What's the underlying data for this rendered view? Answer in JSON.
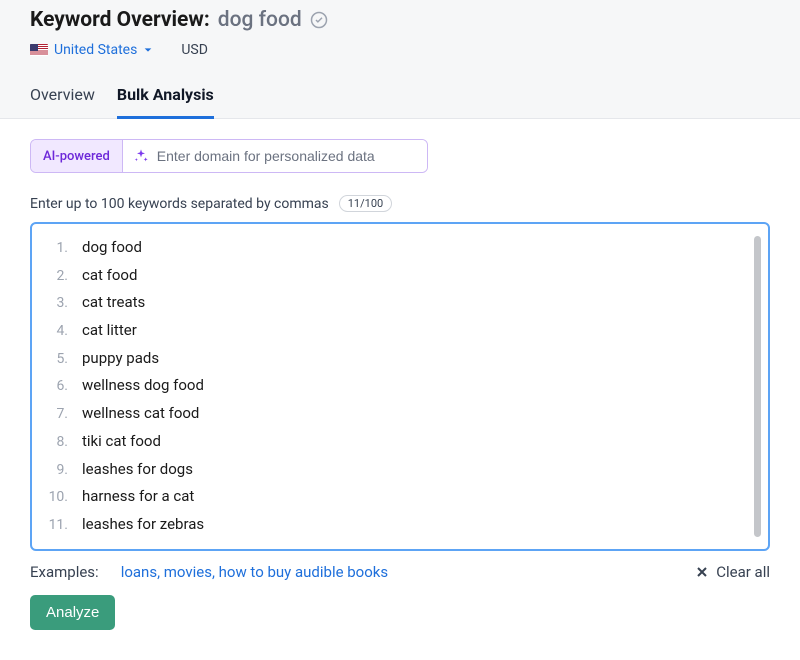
{
  "header": {
    "title_label": "Keyword Overview:",
    "title_query": "dog food",
    "region_name": "United States",
    "currency": "USD"
  },
  "tabs": {
    "overview": "Overview",
    "bulk": "Bulk Analysis"
  },
  "ai": {
    "badge": "AI-powered",
    "placeholder": "Enter domain for personalized data"
  },
  "instruction": {
    "text": "Enter up to 100 keywords separated by commas",
    "counter": "11/100"
  },
  "keywords": [
    "dog food",
    "cat food",
    "cat treats",
    "cat litter",
    "puppy pads",
    "wellness dog food",
    "wellness cat food",
    "tiki cat food",
    "leashes for dogs",
    "harness for a cat",
    "leashes for zebras"
  ],
  "examples": {
    "label": "Examples:",
    "items": "loans, movies, how to buy audible books"
  },
  "actions": {
    "clear": "Clear all",
    "analyze": "Analyze"
  }
}
